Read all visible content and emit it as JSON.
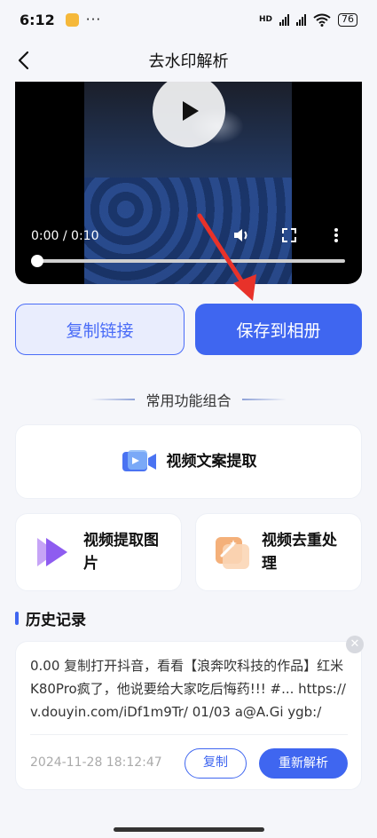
{
  "status": {
    "time": "6:12",
    "dots": "···",
    "hd": "HD",
    "battery": "76"
  },
  "header": {
    "title": "去水印解析"
  },
  "video": {
    "time_text": "0:00 / 0:10",
    "progress": 0.0
  },
  "actions": {
    "copy_link": "复制链接",
    "save_album": "保存到相册"
  },
  "section": {
    "title": "常用功能组合"
  },
  "features": [
    {
      "label": "视频文案提取",
      "icon": "video-camera-icon"
    },
    {
      "label_line1": "视频提取图",
      "label_line2": "片",
      "icon": "play-stack-icon"
    },
    {
      "label_line1": "视频去重处",
      "label_line2": "理",
      "icon": "magic-wand-icon"
    }
  ],
  "history": {
    "title": "历史记录",
    "item": {
      "text": "0.00 复制打开抖音，看看【浪奔吹科技的作品】红米K80Pro疯了，他说要给大家吃后悔药!!! #... https://v.douyin.com/iDf1m9Tr/ 01/03 a@A.Gi ygb:/",
      "date": "2024-11-28 18:12:47",
      "copy_label": "复制",
      "reparse_label": "重新解析"
    }
  },
  "colors": {
    "accent": "#3f66f0",
    "accent_light": "#e9edfd",
    "arrow": "#e8322a"
  }
}
